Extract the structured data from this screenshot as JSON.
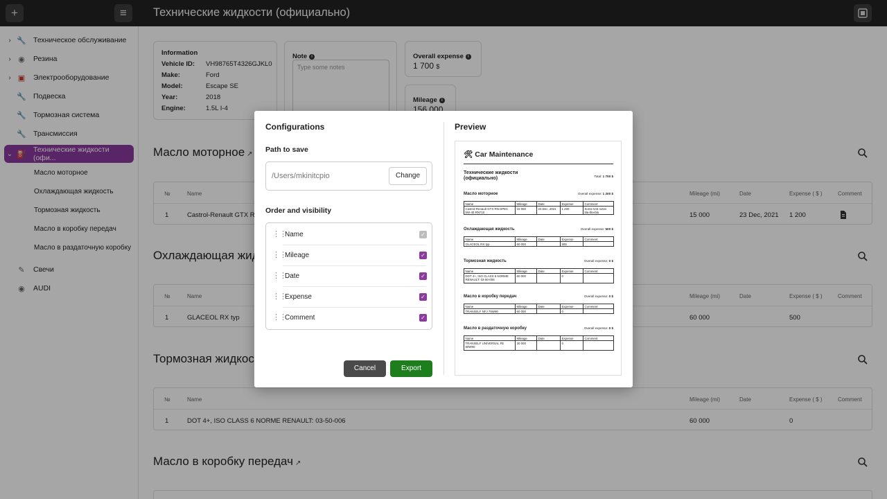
{
  "app": {
    "title": "Технические жидкости (официально)"
  },
  "sidebar": {
    "items": [
      {
        "label": "Техническое обслуживание"
      },
      {
        "label": "Резина"
      },
      {
        "label": "Электрооборудование"
      },
      {
        "label": "Подвеска"
      },
      {
        "label": "Тормозная система"
      },
      {
        "label": "Трансмиссия"
      },
      {
        "label": "Технические жидкости (офи..."
      },
      {
        "label": "Свечи"
      },
      {
        "label": "AUDI"
      }
    ],
    "subitems": [
      {
        "label": "Масло моторное"
      },
      {
        "label": "Охлаждающая жидкость"
      },
      {
        "label": "Тормозная жидкость"
      },
      {
        "label": "Масло в коробку передач"
      },
      {
        "label": "Масло в раздаточную коробку"
      }
    ]
  },
  "info": {
    "title": "Information",
    "rows": [
      {
        "key": "Vehicle ID:",
        "value": "VH98765T4326GJKL0"
      },
      {
        "key": "Make:",
        "value": "Ford"
      },
      {
        "key": "Model:",
        "value": "Escape SE"
      },
      {
        "key": "Year:",
        "value": "2018"
      },
      {
        "key": "Engine:",
        "value": "1.5L I-4"
      }
    ]
  },
  "note": {
    "label": "Note",
    "placeholder": "Type some notes"
  },
  "overall_expense": {
    "label": "Overall expense",
    "value": "1 700",
    "currency": "$"
  },
  "mileage": {
    "label": "Mileage",
    "value": "156 000"
  },
  "table_headers": {
    "num": "№",
    "name": "Name",
    "mileage": "Mileage (mi)",
    "date": "Date",
    "expense": "Expense ( $ )",
    "comment": "Comment"
  },
  "sections": [
    {
      "title": "Масло моторное",
      "row": {
        "num": "1",
        "name": "Castrol-Renault GTX RN-SPEC 5W-40 RN710",
        "mileage": "15 000",
        "date": "23 Dec, 2021",
        "expense": "1 200"
      }
    },
    {
      "title": "Охлаждающая жидкость",
      "row": {
        "num": "1",
        "name": "GLACEOL RX typ",
        "mileage": "60 000",
        "date": "",
        "expense": "500"
      }
    },
    {
      "title": "Тормозная жидкость",
      "row": {
        "num": "1",
        "name": "DOT 4+, ISO CLASS 6 NORME RENAULT: 03-50-006",
        "mileage": "60 000",
        "date": "",
        "expense": "0"
      }
    },
    {
      "title": "Масло в коробку передач"
    }
  ],
  "modal": {
    "config_title": "Configurations",
    "path_label": "Path to save",
    "path_value": "/Users/mkinitcpio",
    "change_label": "Change",
    "order_label": "Order and visibility",
    "columns": [
      {
        "name": "Name",
        "checked": true,
        "disabled": true
      },
      {
        "name": "Mileage",
        "checked": true
      },
      {
        "name": "Date",
        "checked": true
      },
      {
        "name": "Expense",
        "checked": true
      },
      {
        "name": "Comment",
        "checked": true
      }
    ],
    "cancel_label": "Cancel",
    "export_label": "Export",
    "preview_title": "Preview",
    "accent_color": "#8b3a9d",
    "export_color": "#1e7e1e"
  },
  "preview": {
    "app_title": "Car Maintenance",
    "doc_title": "Технические жидкости (официально)",
    "total_label": "Total:",
    "total_value": "1 700 $",
    "overall_label": "Overall expense:",
    "headers": [
      "Name",
      "Mileage",
      "Date",
      "Expense",
      "Comment"
    ],
    "sections": [
      {
        "title": "Масло моторное",
        "overall": "1 200 $",
        "row": [
          "Castrol-Renault GTX RN-SPEC 5W-40 RN710",
          "15 000",
          "23 Dec, 2021",
          "1 200",
          "Some test notes bla-bla-bla"
        ]
      },
      {
        "title": "Охлаждающая жидкость",
        "overall": "500 $",
        "row": [
          "GLACEOL RX typ",
          "60 000",
          "",
          "500",
          ""
        ]
      },
      {
        "title": "Тормозная жидкость",
        "overall": "0 $",
        "row": [
          "DOT 4+, ISO CLASS 6 NORME RENAULT: 03-50-006",
          "60 000",
          "",
          "0",
          ""
        ]
      },
      {
        "title": "Масло в коробку передач",
        "overall": "0 $",
        "row": [
          "TRANSELF NFJ 75W80",
          "60 000",
          "",
          "0",
          ""
        ]
      },
      {
        "title": "Масло в раздаточную коробку",
        "overall": "0 $",
        "row": [
          "TRANSELF UNIVERSAL FE 80W90",
          "30 000",
          "",
          "0",
          ""
        ]
      }
    ]
  }
}
